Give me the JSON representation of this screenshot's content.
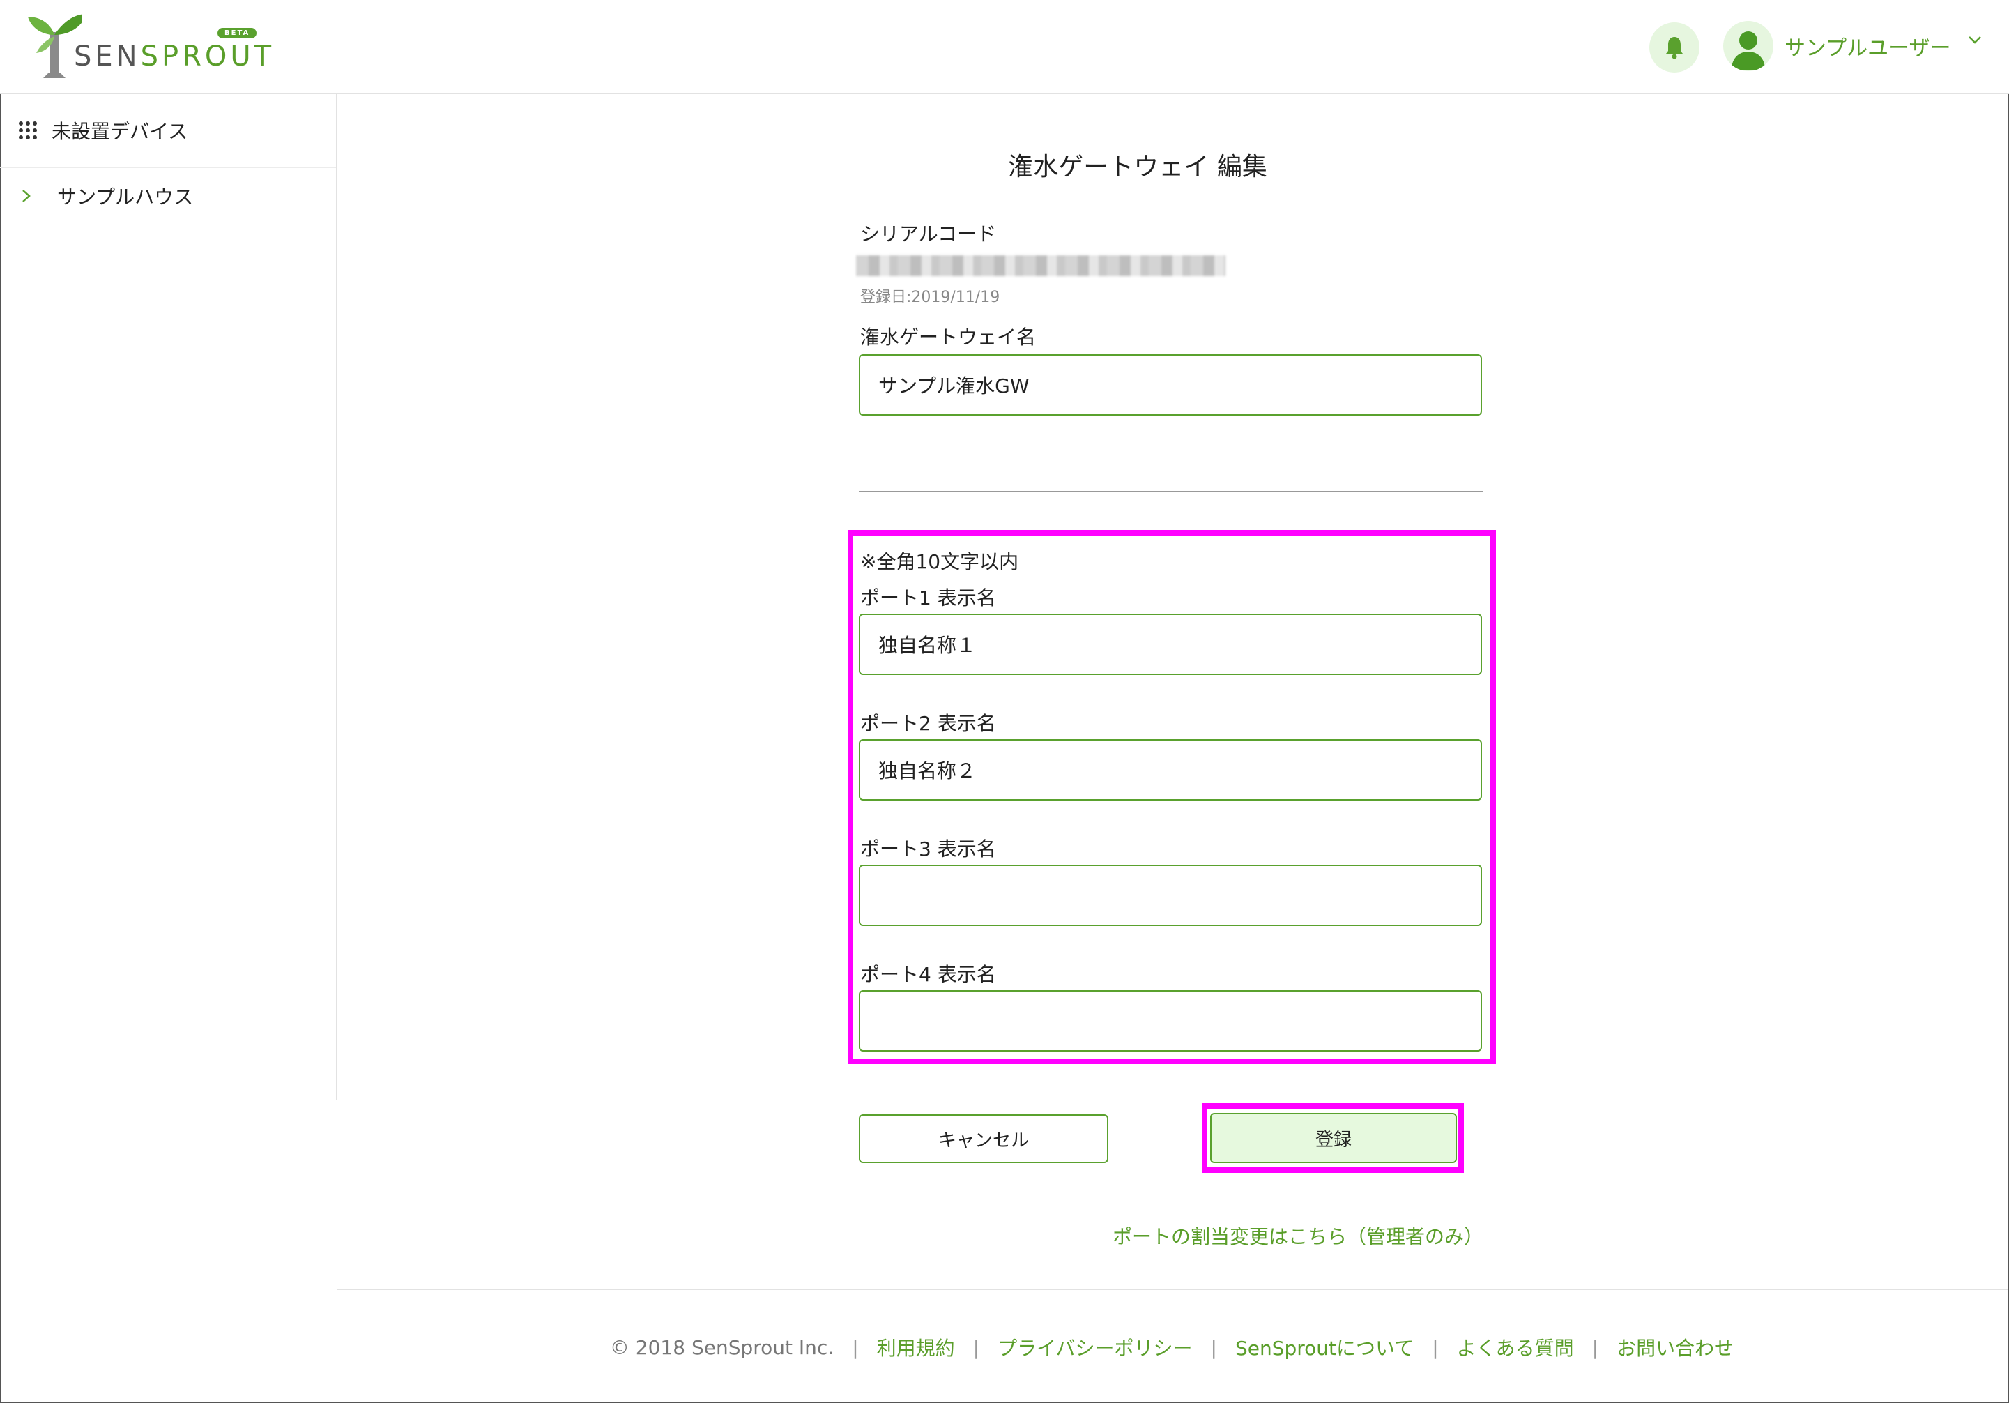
{
  "header": {
    "logo_text_a": "SEN",
    "logo_text_b": "SPROUT",
    "beta": "BETA",
    "user_name": "サンプルユーザー"
  },
  "sidebar": {
    "items": [
      {
        "label": "未設置デバイス"
      },
      {
        "label": "サンプルハウス"
      }
    ]
  },
  "form": {
    "title": "潅水ゲートウェイ 編集",
    "serial_label": "シリアルコード",
    "registered_date": "登録日:2019/11/19",
    "gw_name_label": "潅水ゲートウェイ名",
    "gw_name_value": "サンプル潅水GW",
    "note": "※全角10文字以内",
    "ports": [
      {
        "label": "ポート1 表示名",
        "value": "独自名称１"
      },
      {
        "label": "ポート2 表示名",
        "value": "独自名称２"
      },
      {
        "label": "ポート3 表示名",
        "value": ""
      },
      {
        "label": "ポート4 表示名",
        "value": ""
      }
    ],
    "cancel_label": "キャンセル",
    "submit_label": "登録",
    "port_change_link": "ポートの割当変更はこちら（管理者のみ）"
  },
  "footer": {
    "copyright": "© 2018 SenSprout Inc.",
    "links": [
      "利用規約",
      "プライバシーポリシー",
      "SenSproutについて",
      "よくある質問",
      "お問い合わせ"
    ]
  },
  "colors": {
    "brand_green": "#5aa12e",
    "highlight": "#ff00ff",
    "light_green": "#e6f9de"
  },
  "icons": {
    "logo": "sprout-logo-icon",
    "bell": "bell-icon",
    "avatar": "user-avatar-icon",
    "chevron": "chevron-down-icon",
    "grid": "grid-icon",
    "arrow": "chevron-right-icon"
  }
}
